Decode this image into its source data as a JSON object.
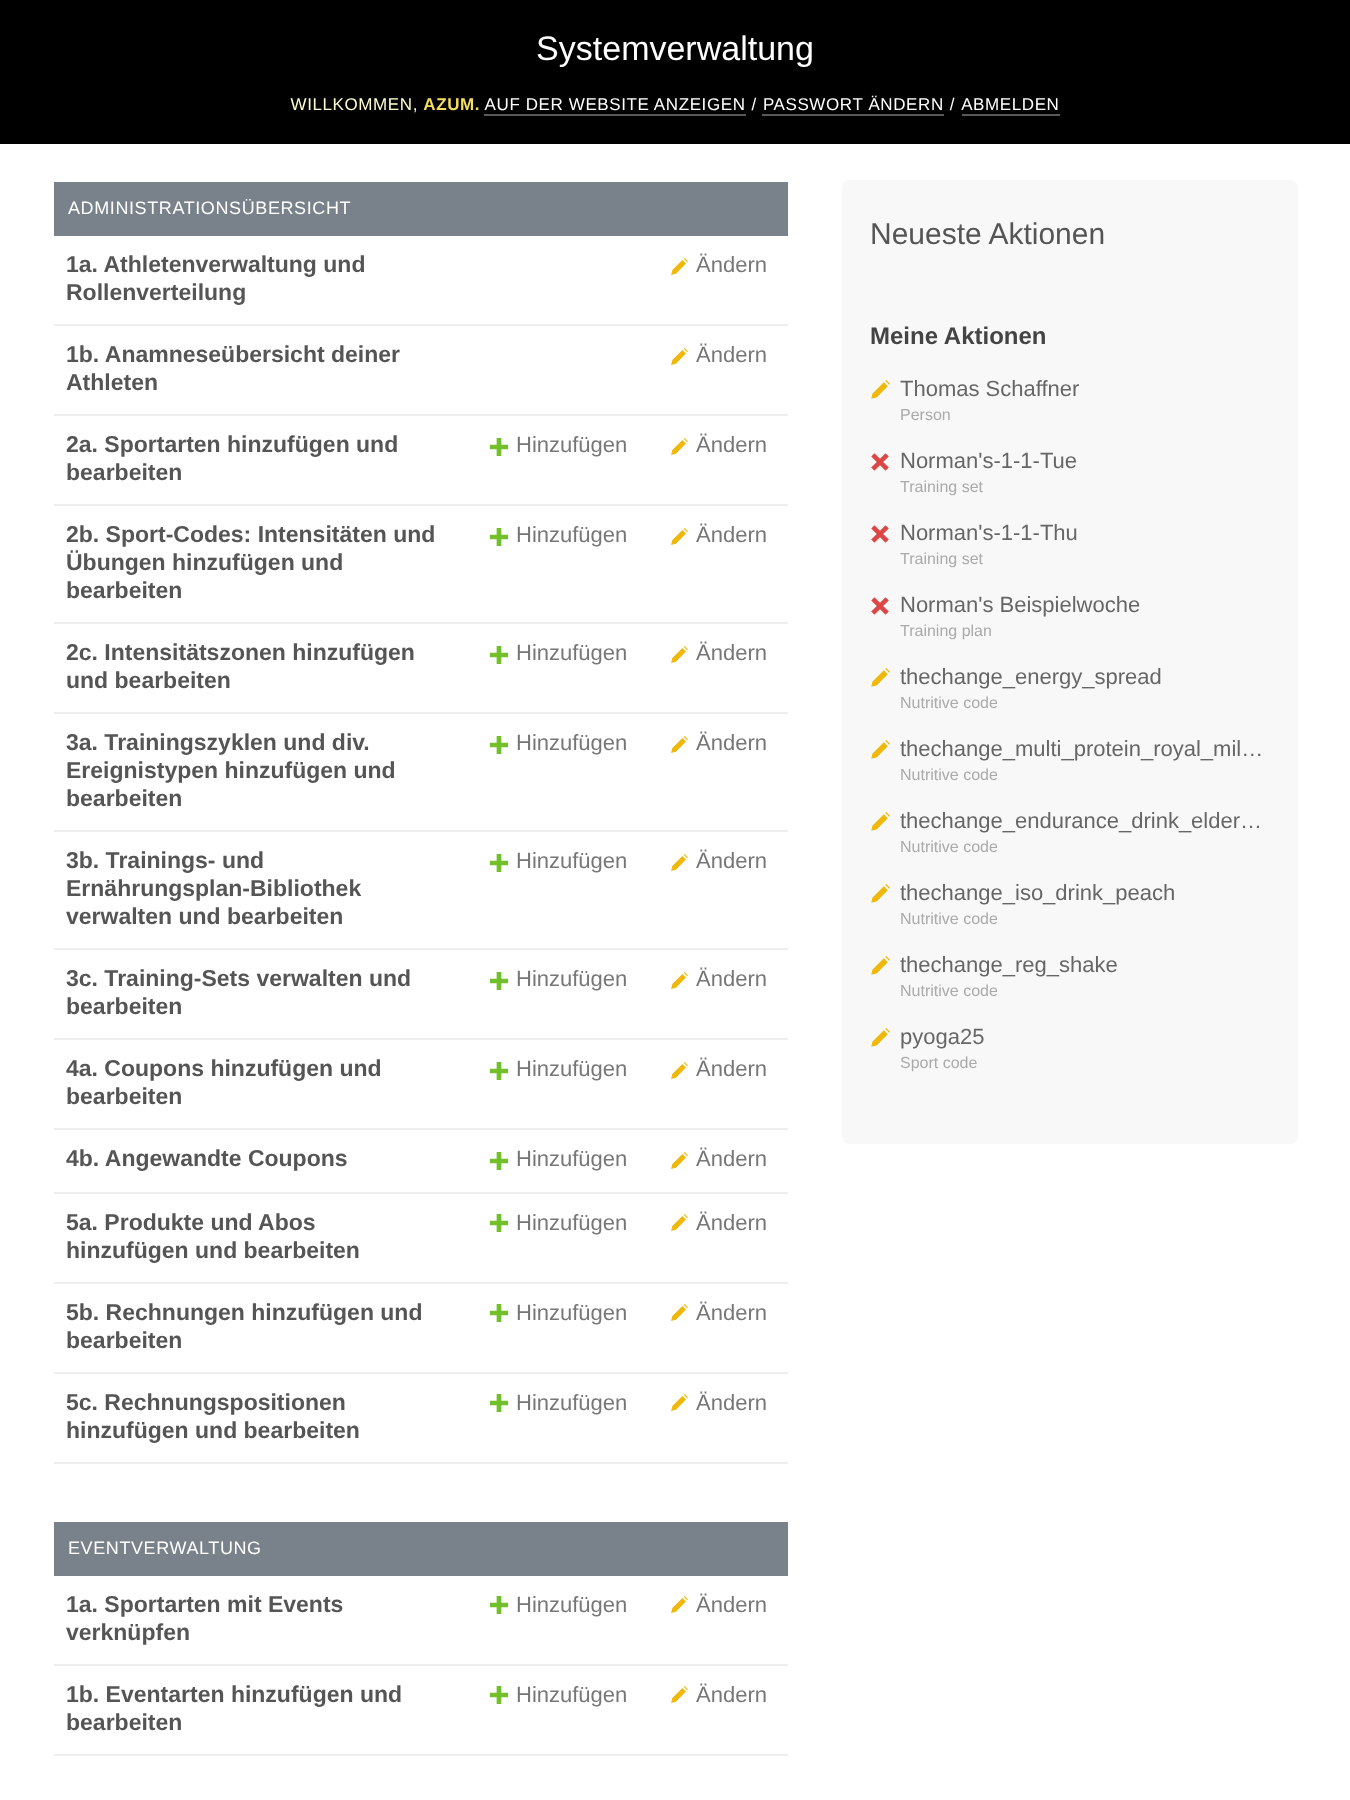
{
  "header": {
    "title": "Systemverwaltung",
    "welcome": "WILLKOMMEN, **AZUM.**",
    "links": [
      {
        "label": "AUF DER WEBSITE ANZEIGEN"
      },
      {
        "label": "PASSWORT ÄNDERN"
      },
      {
        "label": "ABMELDEN"
      }
    ],
    "separators": [
      "/",
      "/"
    ]
  },
  "modules": [
    {
      "title": "ADMINISTRATIONSÜBERSICHT",
      "rows": [
        {
          "label": "1a. Athletenverwaltung und Rollenverteilung",
          "change": "Ändern"
        },
        {
          "label": "1b. Anamneseübersicht deiner Athleten",
          "change": "Ändern"
        },
        {
          "label": "2a. Sportarten hinzufügen und bearbeiten",
          "add": "Hinzufügen",
          "change": "Ändern"
        },
        {
          "label": "2b. Sport-Codes: Intensitäten und Übungen hinzufügen und bearbeiten",
          "add": "Hinzufügen",
          "change": "Ändern"
        },
        {
          "label": "2c. Intensitätszonen hinzufügen und bearbeiten",
          "add": "Hinzufügen",
          "change": "Ändern"
        },
        {
          "label": "3a. Trainingszyklen und div. Ereignistypen hinzufügen und bearbeiten",
          "add": "Hinzufügen",
          "change": "Ändern"
        },
        {
          "label": "3b. Trainings- und Ernährungsplan-Bibliothek verwalten und bearbeiten",
          "add": "Hinzufügen",
          "change": "Ändern"
        },
        {
          "label": "3c. Training-Sets verwalten und bearbeiten",
          "add": "Hinzufügen",
          "change": "Ändern"
        },
        {
          "label": "4a. Coupons hinzufügen und bearbeiten",
          "add": "Hinzufügen",
          "change": "Ändern"
        },
        {
          "label": "4b. Angewandte Coupons",
          "add": "Hinzufügen",
          "change": "Ändern"
        },
        {
          "label": "5a. Produkte und Abos hinzufügen und bearbeiten",
          "add": "Hinzufügen",
          "change": "Ändern"
        },
        {
          "label": "5b. Rechnungen hinzufügen und bearbeiten",
          "add": "Hinzufügen",
          "change": "Ändern"
        },
        {
          "label": "5c. Rechnungspositionen hinzufügen und bearbeiten",
          "add": "Hinzufügen",
          "change": "Ändern"
        }
      ]
    },
    {
      "title": "EVENTVERWALTUNG",
      "rows": [
        {
          "label": "1a. Sportarten mit Events verknüpfen",
          "add": "Hinzufügen",
          "change": "Ändern"
        },
        {
          "label": "1b. Eventarten hinzufügen und bearbeiten",
          "add": "Hinzufügen",
          "change": "Ändern"
        }
      ]
    }
  ],
  "recent_actions": {
    "title": "Neueste Aktionen",
    "subtitle": "Meine Aktionen",
    "items": [
      {
        "kind": "change",
        "name": "Thomas Schaffner",
        "type": "Person"
      },
      {
        "kind": "deletion",
        "name": "Norman's-1-1-Tue",
        "type": "Training set"
      },
      {
        "kind": "deletion",
        "name": "Norman's-1-1-Thu",
        "type": "Training set"
      },
      {
        "kind": "deletion",
        "name": "Norman's Beispielwoche",
        "type": "Training plan"
      },
      {
        "kind": "change",
        "name": "thechange_energy_spread",
        "type": "Nutritive code"
      },
      {
        "kind": "change",
        "name": "thechange_multi_protein_royal_mil…",
        "type": "Nutritive code"
      },
      {
        "kind": "change",
        "name": "thechange_endurance_drink_elder…",
        "type": "Nutritive code"
      },
      {
        "kind": "change",
        "name": "thechange_iso_drink_peach",
        "type": "Nutritive code"
      },
      {
        "kind": "change",
        "name": "thechange_reg_shake",
        "type": "Nutritive code"
      },
      {
        "kind": "change",
        "name": "pyoga25",
        "type": "Sport code"
      }
    ]
  }
}
